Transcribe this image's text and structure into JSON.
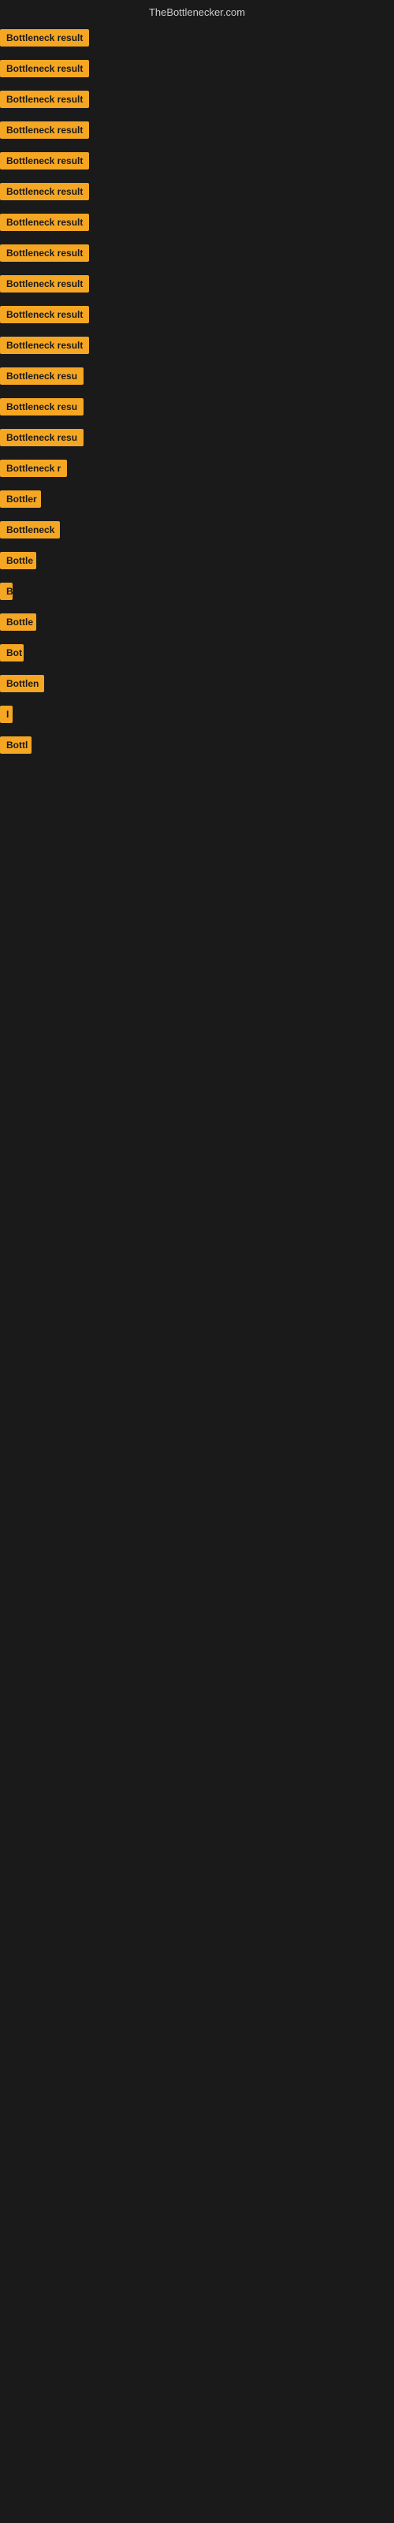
{
  "header": {
    "title": "TheBottlenecker.com"
  },
  "items": [
    {
      "label": "Bottleneck result",
      "width": 120
    },
    {
      "label": "Bottleneck result",
      "width": 120
    },
    {
      "label": "Bottleneck result",
      "width": 120
    },
    {
      "label": "Bottleneck result",
      "width": 120
    },
    {
      "label": "Bottleneck result",
      "width": 120
    },
    {
      "label": "Bottleneck result",
      "width": 120
    },
    {
      "label": "Bottleneck result",
      "width": 120
    },
    {
      "label": "Bottleneck result",
      "width": 120
    },
    {
      "label": "Bottleneck result",
      "width": 120
    },
    {
      "label": "Bottleneck result",
      "width": 120
    },
    {
      "label": "Bottleneck result",
      "width": 120
    },
    {
      "label": "Bottleneck resu",
      "width": 108
    },
    {
      "label": "Bottleneck resu",
      "width": 108
    },
    {
      "label": "Bottleneck resu",
      "width": 108
    },
    {
      "label": "Bottleneck r",
      "width": 88
    },
    {
      "label": "Bottler",
      "width": 52
    },
    {
      "label": "Bottleneck",
      "width": 76
    },
    {
      "label": "Bottle",
      "width": 46
    },
    {
      "label": "B",
      "width": 16
    },
    {
      "label": "Bottle",
      "width": 46
    },
    {
      "label": "Bot",
      "width": 30
    },
    {
      "label": "Bottlen",
      "width": 56
    },
    {
      "label": "I",
      "width": 10
    },
    {
      "label": "Bottl",
      "width": 40
    }
  ]
}
